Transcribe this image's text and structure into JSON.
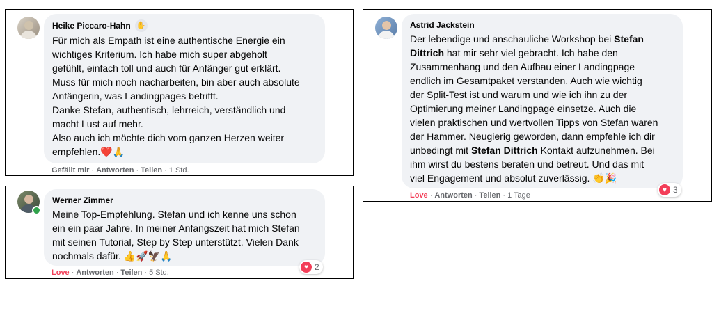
{
  "comments": [
    {
      "author": "Heike Piccaro-Hahn",
      "badge_icon": "wave-hand-icon",
      "text": "Für mich als Empath ist eine authentische Energie ein\nwichtiges Kriterium. Ich habe mich super abgeholt\ngefühlt, einfach toll und auch für Anfänger gut erklärt.\nMuss für mich noch nacharbeiten, bin aber auch absolute\nAnfängerin, was Landingpages betrifft.\nDanke Stefan, authentisch, lehrreich, verständlich und\nmacht Lust auf mehr.\nAlso auch ich möchte dich vom ganzen Herzen weiter\nempfehlen.❤️🙏",
      "actions": {
        "like": "Gefällt mir",
        "reply": "Antworten",
        "share": "Teilen",
        "time": "1 Std."
      }
    },
    {
      "author": "Werner Zimmer",
      "text": "Meine Top-Empfehlung. Stefan und ich kenne uns schon\nein ein paar Jahre. In meiner Anfangszeit hat mich Stefan\nmit seinen Tutorial, Step by Step unterstützt. Vielen Dank\nnochmals dafür. 👍🚀🦅🙏",
      "actions": {
        "like": "Love",
        "reply": "Antworten",
        "share": "Teilen",
        "time": "5 Std."
      },
      "reaction_count": "2"
    },
    {
      "author": "Astrid Jackstein",
      "text_parts": {
        "p1": "Der lebendige und anschauliche Workshop bei ",
        "b1": "Stefan\nDittrich",
        "p2": " hat mir sehr viel gebracht. Ich habe den\nZusammenhang und den Aufbau einer Landingpage\nendlich im Gesamtpaket verstanden. Auch wie wichtig\nder Split-Test ist und warum und wie ich ihn zu der\nOptimierung meiner Landingpage einsetze. Auch die\nvielen praktischen und wertvollen Tipps von Stefan waren\nder Hammer. Neugierig geworden, dann empfehle ich dir\nunbedingt mit ",
        "b2": "Stefan Dittrich",
        "p3": " Kontakt aufzunehmen. Bei\nihm wirst du bestens beraten und betreut. Und das mit\nviel Engagement und absolut zuverlässig. 👏🎉"
      },
      "actions": {
        "like": "Love",
        "reply": "Antworten",
        "share": "Teilen",
        "time": "1 Tage"
      },
      "reaction_count": "3"
    }
  ],
  "separator": "·",
  "colors": {
    "bubble": "#f0f2f5",
    "love": "#f33e58",
    "meta": "#65676b",
    "online": "#31a24c"
  }
}
